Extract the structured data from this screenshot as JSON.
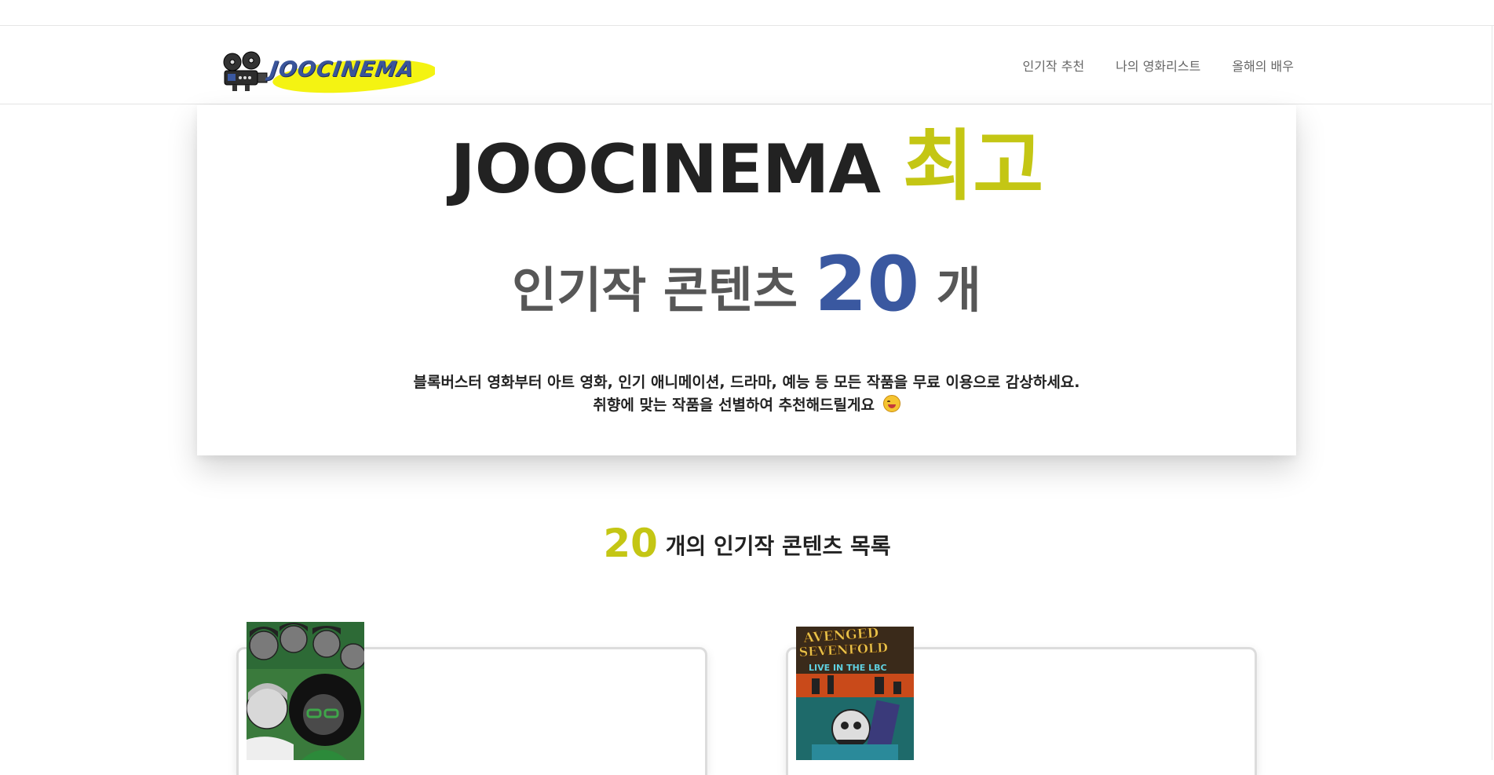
{
  "brand": {
    "logo_text": "JOOCINEMA"
  },
  "nav": {
    "items": [
      {
        "label": "인기작 추천"
      },
      {
        "label": "나의 영화리스트"
      },
      {
        "label": "올해의 배우"
      }
    ]
  },
  "hero": {
    "title_main": "JOOCINEMA",
    "title_accent": "최고",
    "sub_prefix": "인기작 콘텐츠",
    "sub_count": "20",
    "sub_suffix": "개",
    "desc_line1": "블록버스터 영화부터 아트 영화, 인기 애니메이션, 드라마, 예능 등 모든 작품을 무료 이용으로 감상하세요.",
    "desc_line2": "취향에 맞는 작품을 선별하여 추천해드릴게요"
  },
  "list": {
    "count": "20",
    "title_suffix": "개의 인기작 콘텐츠 목록"
  },
  "cards": [
    {
      "poster_title": ""
    },
    {
      "poster_title_lines": [
        "AVENGED",
        "SEVENFOLD",
        "LIVE IN THE LBC"
      ]
    }
  ],
  "colors": {
    "accent_yellow": "#c4c614",
    "accent_blue": "#3a58a0",
    "text_dark": "#222222",
    "text_gray": "#575757"
  },
  "icons": {
    "logo_icon": "film-camera-icon",
    "emoji": "yummy-face-emoji-icon"
  }
}
